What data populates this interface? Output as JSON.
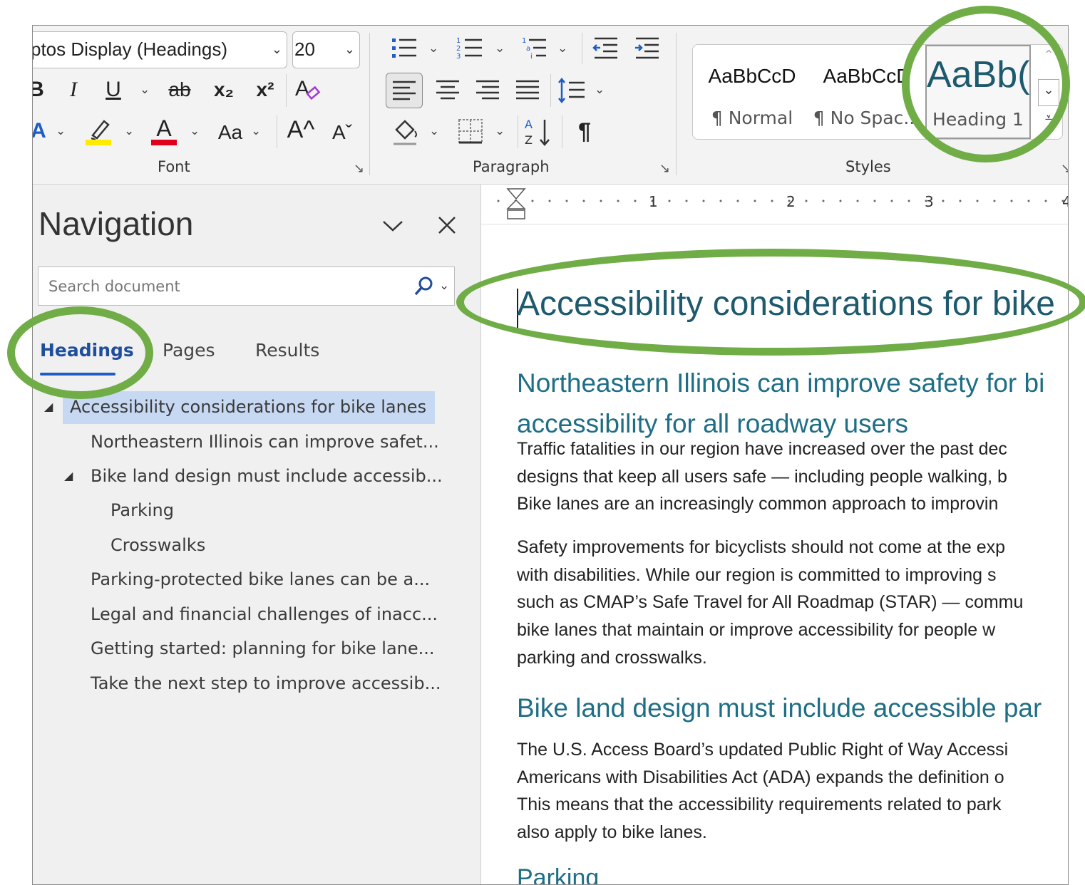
{
  "ribbon": {
    "font_name": "ptos Display (Headings)",
    "font_size": "20",
    "font_label": "Font",
    "paragraph_label": "Paragraph",
    "styles_label": "Styles",
    "bold_glyph": "B",
    "italic_glyph": "I",
    "underline_glyph": "U",
    "strike_glyph": "ab",
    "subscript_glyph": "x₂",
    "superscript_glyph": "x²",
    "change_case_glyph": "Aa",
    "grow_font_glyph": "A^",
    "shrink_font_glyph": "Aˇ",
    "pilcrow_glyph": "¶",
    "styles": [
      {
        "sample": "AaBbCcD",
        "name": "¶ Normal"
      },
      {
        "sample": "AaBbCcD",
        "name": "¶ No Spac..."
      },
      {
        "sample": "AaBb(",
        "name": "Heading 1"
      }
    ],
    "highlight_color": "#ffea00",
    "font_color": "#e0001b"
  },
  "nav": {
    "title": "Navigation",
    "search_placeholder": "Search document",
    "tabs": [
      "Headings",
      "Pages",
      "Results"
    ],
    "headings": [
      "Accessibility considerations for bike lanes",
      "Northeastern Illinois can improve safet...",
      "Bike land design must include accessib...",
      "Parking",
      "Crosswalks",
      "Parking-protected bike lanes can be a...",
      "Legal and financial challenges of inacc...",
      "Getting started: planning for bike lane...",
      "Take the next step to improve accessib..."
    ]
  },
  "ruler": {
    "marks": [
      "1",
      "2",
      "3",
      "4"
    ]
  },
  "document": {
    "title": "Accessibility considerations for bike",
    "h2_line1": "Northeastern Illinois can improve safety for bi",
    "h2_line2": "accessibility for all roadway users",
    "p1": [
      "Traffic fatalities in our region have increased over the past dec",
      "designs that keep all users safe — including people walking, b",
      "Bike lanes are an increasingly common approach to improvin"
    ],
    "p2": [
      "Safety improvements for bicyclists should not come at the exp",
      "with disabilities. While our region is committed to improving s",
      "such as CMAP’s Safe Travel for All Roadmap (STAR) — commu",
      "bike lanes that maintain or improve accessibility for people w",
      "parking and crosswalks."
    ],
    "h2_b": "Bike land design must include accessible par",
    "p3": [
      "The U.S. Access Board’s updated Public Right of Way Accessi",
      "Americans with Disabilities Act (ADA) expands the definition o",
      "This means that the accessibility requirements related to park",
      "also apply to bike lanes."
    ],
    "h3": "Parking"
  },
  "highlight_color": "#70ad47"
}
